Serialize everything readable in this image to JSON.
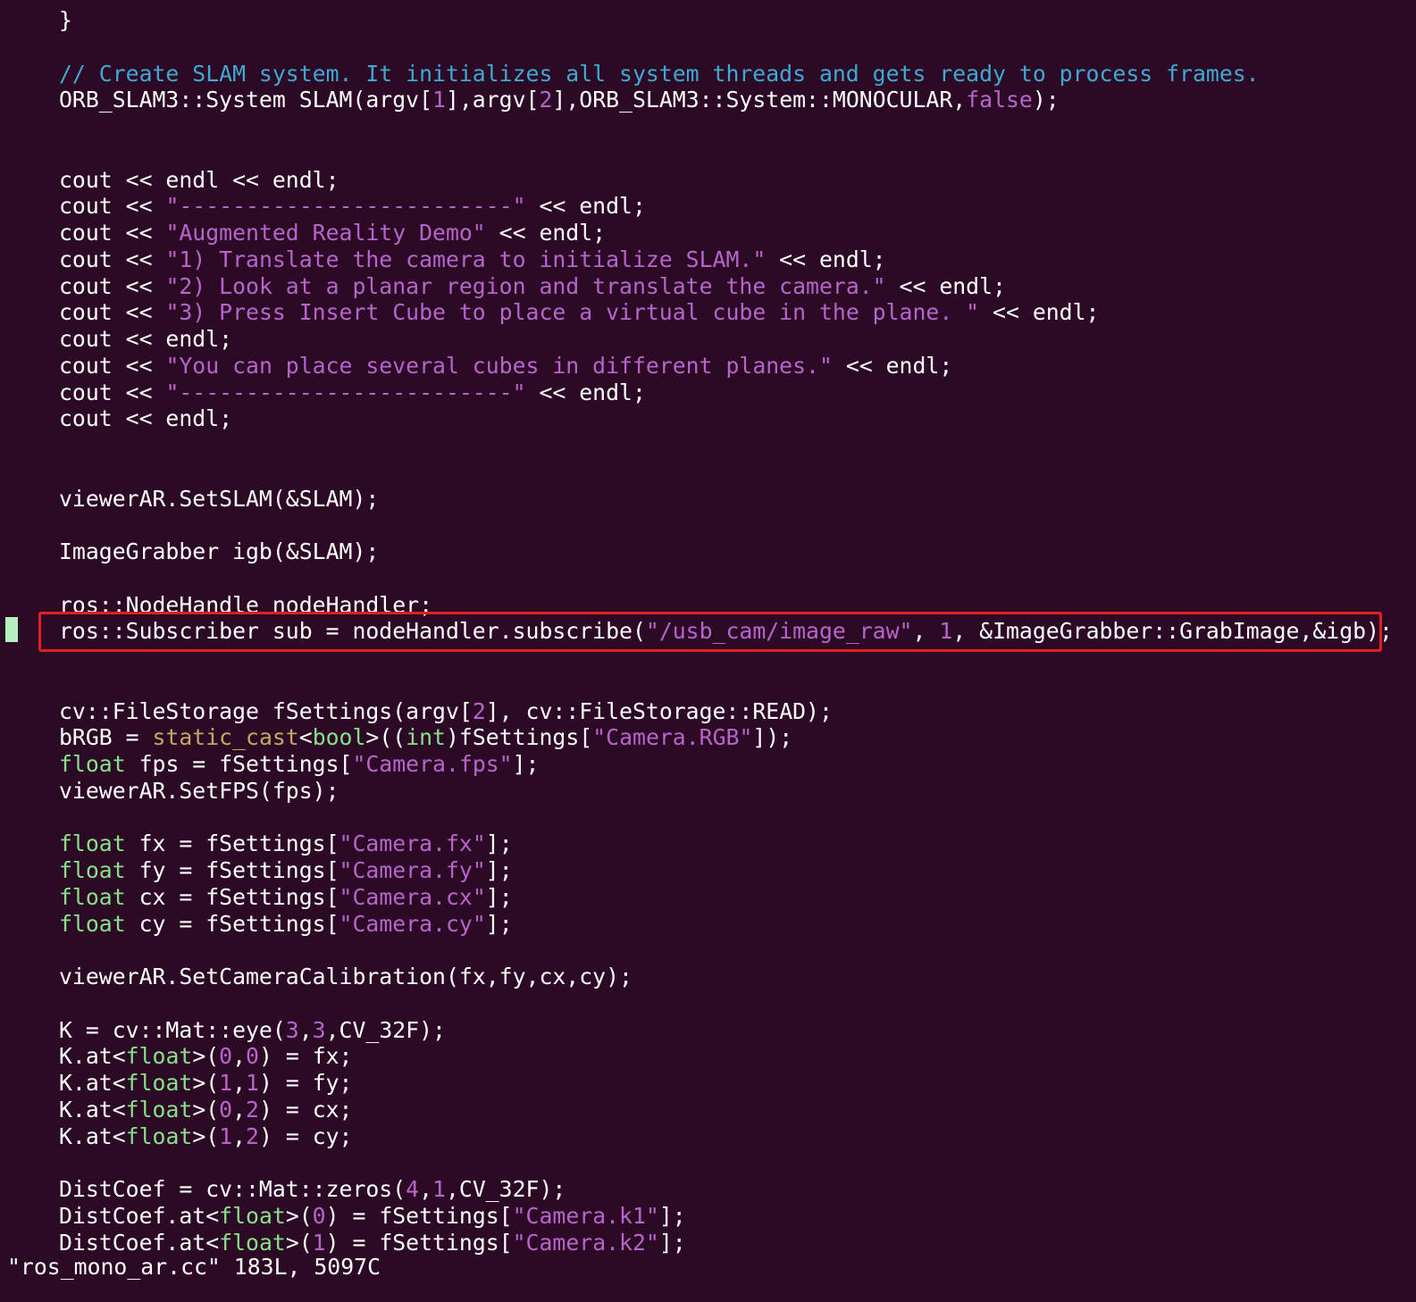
{
  "editor": {
    "filename": "ros_mono_ar.cc",
    "status": "\"ros_mono_ar.cc\" 183L, 5097C",
    "colors": {
      "background": "#2c0a25",
      "comment": "#3fa9d3",
      "string": "#b765cc",
      "number": "#b765cc",
      "keyword": "#b765cc",
      "type": "#8ae08a",
      "cast": "#c6a860",
      "text": "#ffffff",
      "highlight_border": "#e02020",
      "cursor": "#b5f0c0"
    },
    "highlighted_line": 14,
    "lines": [
      {
        "row": 0,
        "indent": 0,
        "tokens": [
          [
            "plain",
            "}"
          ]
        ]
      },
      {
        "row": 2,
        "indent": 0,
        "tokens": [
          [
            "comment",
            "// Create SLAM system. It initializes all system threads and gets ready to process frames."
          ]
        ]
      },
      {
        "row": 3,
        "indent": 0,
        "tokens": [
          [
            "plain",
            "ORB_SLAM3::System SLAM(argv["
          ],
          [
            "number",
            "1"
          ],
          [
            "plain",
            "],argv["
          ],
          [
            "number",
            "2"
          ],
          [
            "plain",
            "],ORB_SLAM3::System::MONOCULAR,"
          ],
          [
            "keyword",
            "false"
          ],
          [
            "plain",
            ");"
          ]
        ]
      },
      {
        "row": 6,
        "indent": 0,
        "tokens": [
          [
            "plain",
            "cout << endl << endl;"
          ]
        ]
      },
      {
        "row": 7,
        "indent": 0,
        "tokens": [
          [
            "plain",
            "cout << "
          ],
          [
            "string",
            "\"-------------------------\""
          ],
          [
            "plain",
            " << endl;"
          ]
        ]
      },
      {
        "row": 8,
        "indent": 0,
        "tokens": [
          [
            "plain",
            "cout << "
          ],
          [
            "string",
            "\"Augmented Reality Demo\""
          ],
          [
            "plain",
            " << endl;"
          ]
        ]
      },
      {
        "row": 9,
        "indent": 0,
        "tokens": [
          [
            "plain",
            "cout << "
          ],
          [
            "string",
            "\"1) Translate the camera to initialize SLAM.\""
          ],
          [
            "plain",
            " << endl;"
          ]
        ]
      },
      {
        "row": 10,
        "indent": 0,
        "tokens": [
          [
            "plain",
            "cout << "
          ],
          [
            "string",
            "\"2) Look at a planar region and translate the camera.\""
          ],
          [
            "plain",
            " << endl;"
          ]
        ]
      },
      {
        "row": 11,
        "indent": 0,
        "tokens": [
          [
            "plain",
            "cout << "
          ],
          [
            "string",
            "\"3) Press Insert Cube to place a virtual cube in the plane. \""
          ],
          [
            "plain",
            " << endl;"
          ]
        ]
      },
      {
        "row": 12,
        "indent": 0,
        "tokens": [
          [
            "plain",
            "cout << endl;"
          ]
        ]
      },
      {
        "row": 13,
        "indent": 0,
        "tokens": [
          [
            "plain",
            "cout << "
          ],
          [
            "string",
            "\"You can place several cubes in different planes.\""
          ],
          [
            "plain",
            " << endl;"
          ]
        ]
      },
      {
        "row": 14,
        "indent": 0,
        "tokens": [
          [
            "plain",
            "cout << "
          ],
          [
            "string",
            "\"-------------------------\""
          ],
          [
            "plain",
            " << endl;"
          ]
        ]
      },
      {
        "row": 15,
        "indent": 0,
        "tokens": [
          [
            "plain",
            "cout << endl;"
          ]
        ]
      },
      {
        "row": 18,
        "indent": 0,
        "tokens": [
          [
            "plain",
            "viewerAR.SetSLAM(&SLAM);"
          ]
        ]
      },
      {
        "row": 20,
        "indent": 0,
        "tokens": [
          [
            "plain",
            "ImageGrabber igb(&SLAM);"
          ]
        ]
      },
      {
        "row": 22,
        "indent": 0,
        "tokens": [
          [
            "plain",
            "ros::NodeHandle nodeHandler;"
          ]
        ]
      },
      {
        "row": 23,
        "indent": 0,
        "tokens": [
          [
            "plain",
            "ros::Subscriber sub = nodeHandler.subscribe("
          ],
          [
            "string",
            "\"/usb_cam/image_raw\""
          ],
          [
            "plain",
            ", "
          ],
          [
            "number",
            "1"
          ],
          [
            "plain",
            ", &ImageGrabber::GrabImage,&igb);"
          ]
        ]
      },
      {
        "row": 26,
        "indent": 0,
        "tokens": [
          [
            "plain",
            "cv::FileStorage fSettings(argv["
          ],
          [
            "number",
            "2"
          ],
          [
            "plain",
            "], cv::FileStorage::READ);"
          ]
        ]
      },
      {
        "row": 27,
        "indent": 0,
        "tokens": [
          [
            "plain",
            "bRGB = "
          ],
          [
            "cast",
            "static_cast"
          ],
          [
            "plain",
            "<"
          ],
          [
            "type",
            "bool"
          ],
          [
            "plain",
            ">(("
          ],
          [
            "type",
            "int"
          ],
          [
            "plain",
            ")fSettings["
          ],
          [
            "string",
            "\"Camera.RGB\""
          ],
          [
            "plain",
            "]);"
          ]
        ]
      },
      {
        "row": 28,
        "indent": 0,
        "tokens": [
          [
            "type",
            "float"
          ],
          [
            "plain",
            " fps = fSettings["
          ],
          [
            "string",
            "\"Camera.fps\""
          ],
          [
            "plain",
            "];"
          ]
        ]
      },
      {
        "row": 29,
        "indent": 0,
        "tokens": [
          [
            "plain",
            "viewerAR.SetFPS(fps);"
          ]
        ]
      },
      {
        "row": 31,
        "indent": 0,
        "tokens": [
          [
            "type",
            "float"
          ],
          [
            "plain",
            " fx = fSettings["
          ],
          [
            "string",
            "\"Camera.fx\""
          ],
          [
            "plain",
            "];"
          ]
        ]
      },
      {
        "row": 32,
        "indent": 0,
        "tokens": [
          [
            "type",
            "float"
          ],
          [
            "plain",
            " fy = fSettings["
          ],
          [
            "string",
            "\"Camera.fy\""
          ],
          [
            "plain",
            "];"
          ]
        ]
      },
      {
        "row": 33,
        "indent": 0,
        "tokens": [
          [
            "type",
            "float"
          ],
          [
            "plain",
            " cx = fSettings["
          ],
          [
            "string",
            "\"Camera.cx\""
          ],
          [
            "plain",
            "];"
          ]
        ]
      },
      {
        "row": 34,
        "indent": 0,
        "tokens": [
          [
            "type",
            "float"
          ],
          [
            "plain",
            " cy = fSettings["
          ],
          [
            "string",
            "\"Camera.cy\""
          ],
          [
            "plain",
            "];"
          ]
        ]
      },
      {
        "row": 36,
        "indent": 0,
        "tokens": [
          [
            "plain",
            "viewerAR.SetCameraCalibration(fx,fy,cx,cy);"
          ]
        ]
      },
      {
        "row": 38,
        "indent": 0,
        "tokens": [
          [
            "plain",
            "K = cv::Mat::eye("
          ],
          [
            "number",
            "3"
          ],
          [
            "plain",
            ","
          ],
          [
            "number",
            "3"
          ],
          [
            "plain",
            ",CV_32F);"
          ]
        ]
      },
      {
        "row": 39,
        "indent": 0,
        "tokens": [
          [
            "plain",
            "K.at<"
          ],
          [
            "type",
            "float"
          ],
          [
            "plain",
            ">("
          ],
          [
            "number",
            "0"
          ],
          [
            "plain",
            ","
          ],
          [
            "number",
            "0"
          ],
          [
            "plain",
            ") = fx;"
          ]
        ]
      },
      {
        "row": 40,
        "indent": 0,
        "tokens": [
          [
            "plain",
            "K.at<"
          ],
          [
            "type",
            "float"
          ],
          [
            "plain",
            ">("
          ],
          [
            "number",
            "1"
          ],
          [
            "plain",
            ","
          ],
          [
            "number",
            "1"
          ],
          [
            "plain",
            ") = fy;"
          ]
        ]
      },
      {
        "row": 41,
        "indent": 0,
        "tokens": [
          [
            "plain",
            "K.at<"
          ],
          [
            "type",
            "float"
          ],
          [
            "plain",
            ">("
          ],
          [
            "number",
            "0"
          ],
          [
            "plain",
            ","
          ],
          [
            "number",
            "2"
          ],
          [
            "plain",
            ") = cx;"
          ]
        ]
      },
      {
        "row": 42,
        "indent": 0,
        "tokens": [
          [
            "plain",
            "K.at<"
          ],
          [
            "type",
            "float"
          ],
          [
            "plain",
            ">("
          ],
          [
            "number",
            "1"
          ],
          [
            "plain",
            ","
          ],
          [
            "number",
            "2"
          ],
          [
            "plain",
            ") = cy;"
          ]
        ]
      },
      {
        "row": 44,
        "indent": 0,
        "tokens": [
          [
            "plain",
            "DistCoef = cv::Mat::zeros("
          ],
          [
            "number",
            "4"
          ],
          [
            "plain",
            ","
          ],
          [
            "number",
            "1"
          ],
          [
            "plain",
            ",CV_32F);"
          ]
        ]
      },
      {
        "row": 45,
        "indent": 0,
        "tokens": [
          [
            "plain",
            "DistCoef.at<"
          ],
          [
            "type",
            "float"
          ],
          [
            "plain",
            ">("
          ],
          [
            "number",
            "0"
          ],
          [
            "plain",
            ") = fSettings["
          ],
          [
            "string",
            "\"Camera.k1\""
          ],
          [
            "plain",
            "];"
          ]
        ]
      },
      {
        "row": 46,
        "indent": 0,
        "tokens": [
          [
            "plain",
            "DistCoef.at<"
          ],
          [
            "type",
            "float"
          ],
          [
            "plain",
            ">("
          ],
          [
            "number",
            "1"
          ],
          [
            "plain",
            ") = fSettings["
          ],
          [
            "string",
            "\"Camera.k2\""
          ],
          [
            "plain",
            "];"
          ]
        ]
      }
    ]
  }
}
